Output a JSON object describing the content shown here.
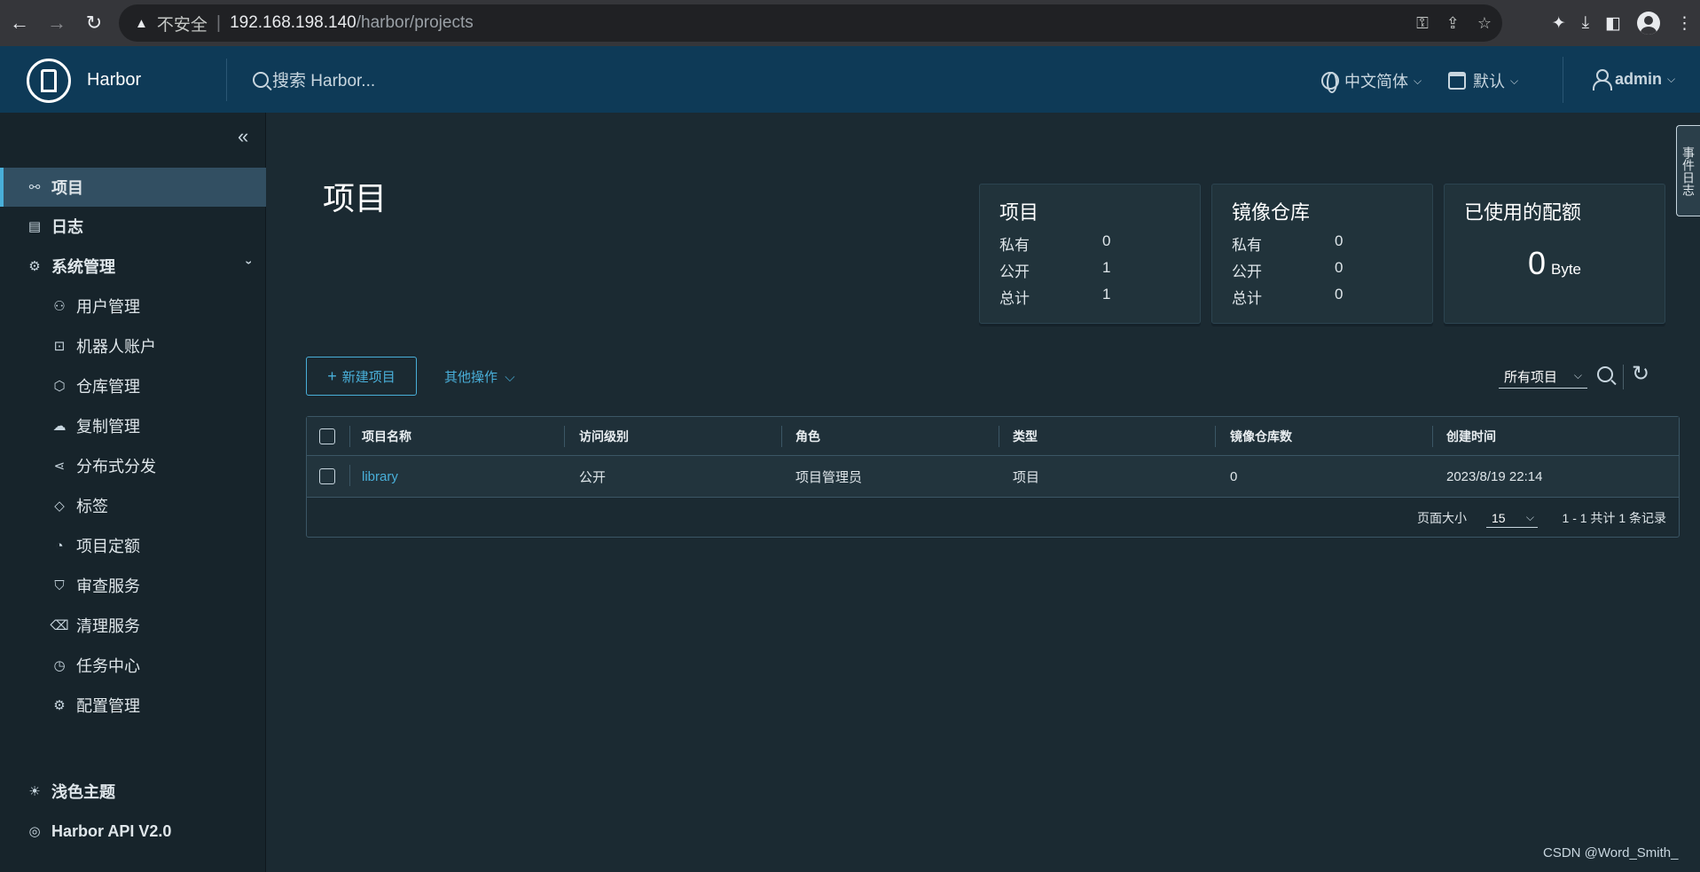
{
  "browser": {
    "insecure_label": "不安全",
    "url_host": "192.168.198.140",
    "url_path": "/harbor/projects"
  },
  "header": {
    "brand": "Harbor",
    "search_placeholder": "搜索 Harbor...",
    "language": "中文简体",
    "datetime_format": "默认",
    "user": "admin"
  },
  "sidebar": {
    "items": [
      {
        "label": "项目",
        "icon": "projects-icon"
      },
      {
        "label": "日志",
        "icon": "logs-icon"
      },
      {
        "label": "系统管理",
        "icon": "admin-icon"
      }
    ],
    "sub_items": [
      {
        "label": "用户管理",
        "icon": "users-icon"
      },
      {
        "label": "机器人账户",
        "icon": "robot-icon"
      },
      {
        "label": "仓库管理",
        "icon": "registry-icon"
      },
      {
        "label": "复制管理",
        "icon": "replication-icon"
      },
      {
        "label": "分布式分发",
        "icon": "share-icon"
      },
      {
        "label": "标签",
        "icon": "tag-icon"
      },
      {
        "label": "项目定额",
        "icon": "quota-icon"
      },
      {
        "label": "审查服务",
        "icon": "shield-icon"
      },
      {
        "label": "清理服务",
        "icon": "trash-icon"
      },
      {
        "label": "任务中心",
        "icon": "dashboard-icon"
      },
      {
        "label": "配置管理",
        "icon": "gear-icon"
      }
    ],
    "footer": [
      {
        "label": "浅色主题",
        "icon": "sun-icon"
      },
      {
        "label": "Harbor API V2.0",
        "icon": "api-icon"
      }
    ]
  },
  "page": {
    "title": "项目"
  },
  "cards": {
    "projects": {
      "title": "项目",
      "private_label": "私有",
      "private": "0",
      "public_label": "公开",
      "public": "1",
      "total_label": "总计",
      "total": "1"
    },
    "repositories": {
      "title": "镜像仓库",
      "private_label": "私有",
      "private": "0",
      "public_label": "公开",
      "public": "0",
      "total_label": "总计",
      "total": "0"
    },
    "quota": {
      "title": "已使用的配额",
      "value": "0",
      "unit": "Byte"
    }
  },
  "toolbar": {
    "new_project": "新建项目",
    "other_actions": "其他操作",
    "filter": "所有项目"
  },
  "table": {
    "columns": [
      "项目名称",
      "访问级别",
      "角色",
      "类型",
      "镜像仓库数",
      "创建时间"
    ],
    "rows": [
      {
        "name": "library",
        "access": "公开",
        "role": "项目管理员",
        "type": "项目",
        "repo_count": "0",
        "created": "2023/8/19 22:14"
      }
    ],
    "page_size_label": "页面大小",
    "page_size": "15",
    "count_text": "1 - 1 共计 1 条记录"
  },
  "feedback_tab": "事件日志",
  "watermark": "CSDN @Word_Smith_",
  "colors": {
    "accent": "#49afd9",
    "header": "#0e3a57",
    "background": "#1b2a32",
    "sidebar": "#17242b"
  }
}
